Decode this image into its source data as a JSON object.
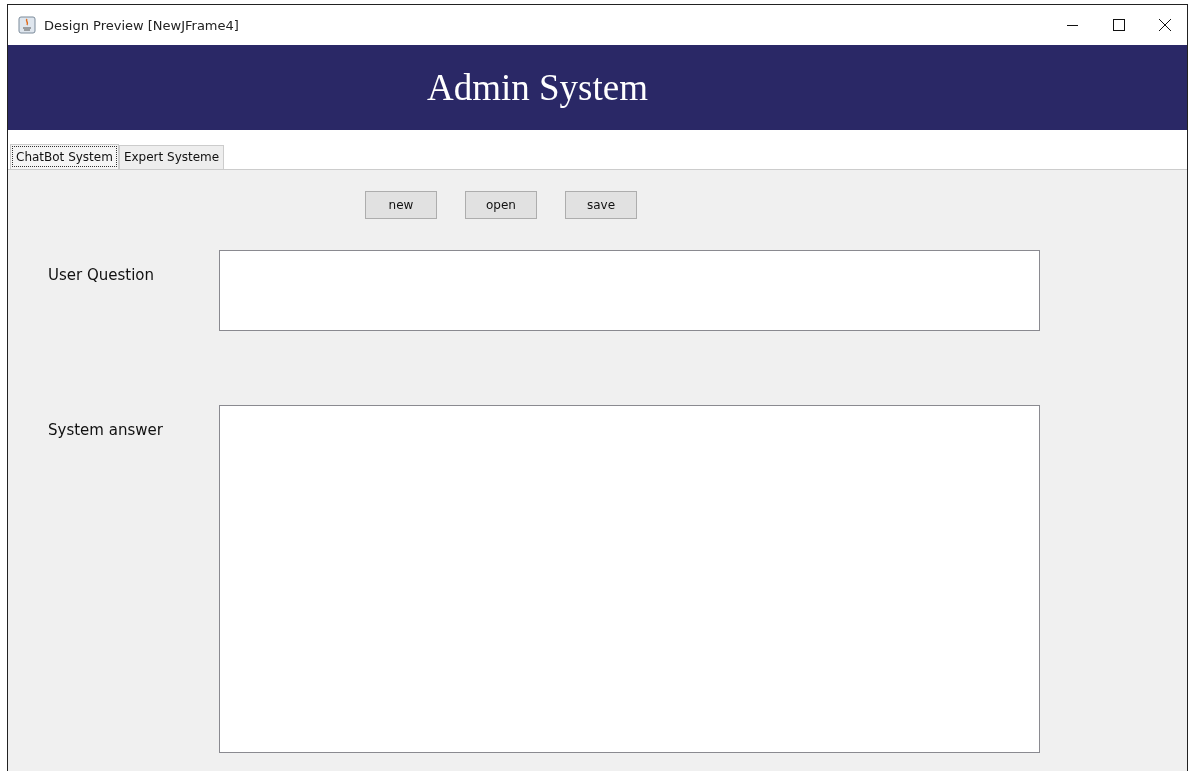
{
  "window": {
    "title": "Design Preview [NewJFrame4]"
  },
  "header": {
    "title": "Admin System"
  },
  "tabs": [
    {
      "label": "ChatBot System",
      "selected": true
    },
    {
      "label": "Expert Systeme",
      "selected": false
    }
  ],
  "toolbar": {
    "buttons": [
      "new",
      "open",
      "save"
    ]
  },
  "form": {
    "fields": [
      {
        "label": "User Question",
        "kind": "short"
      },
      {
        "label": "System answer",
        "kind": "long"
      }
    ]
  }
}
